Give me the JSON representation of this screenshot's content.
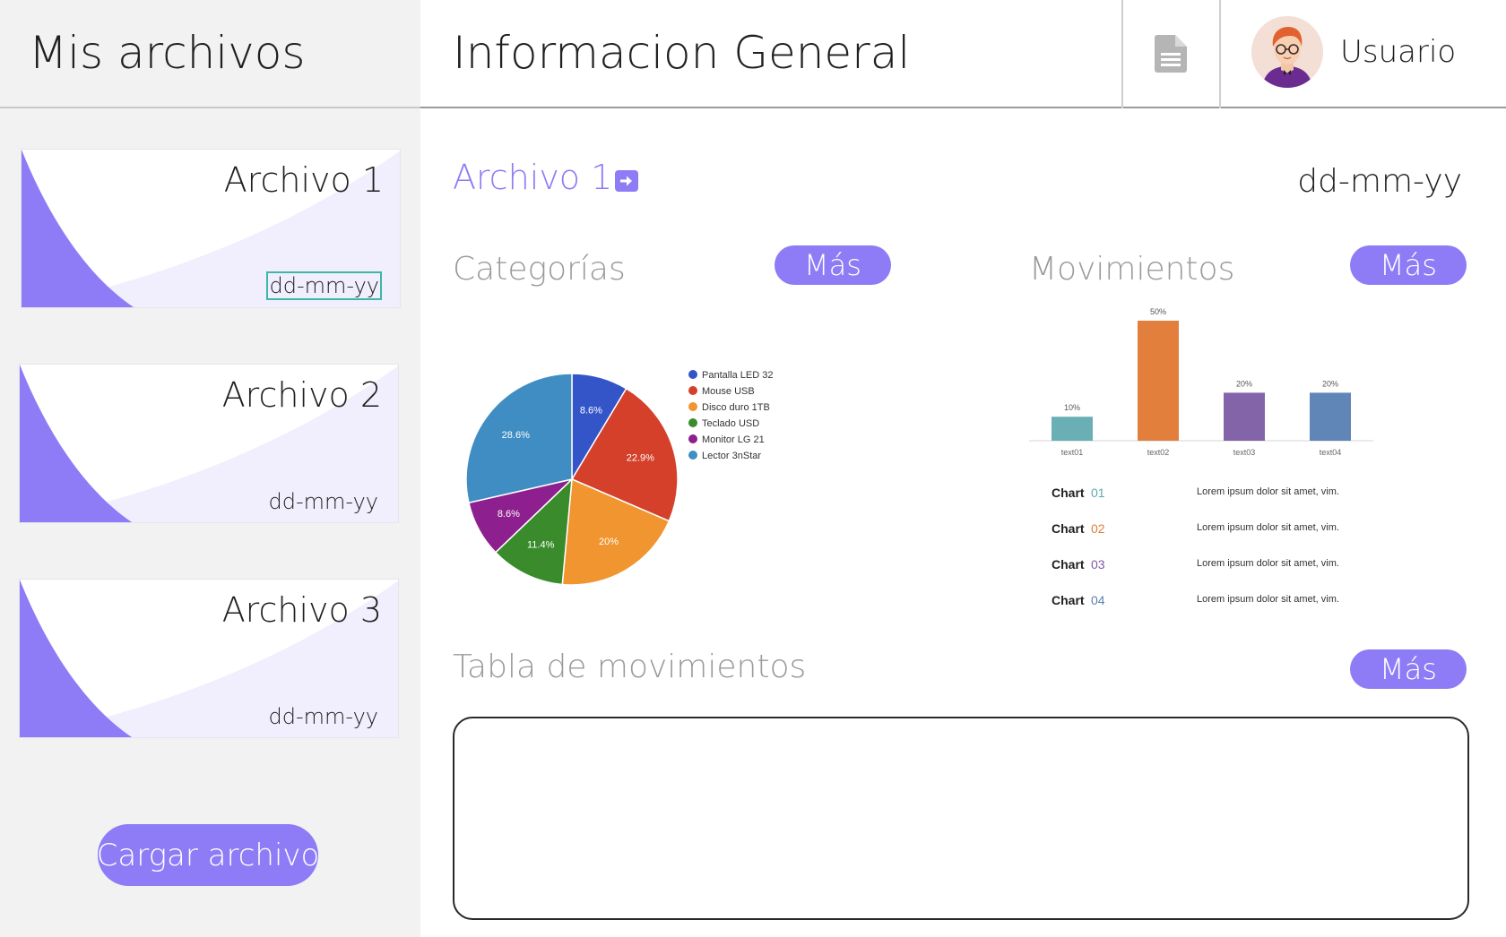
{
  "colors": {
    "accent": "#8d7cf6",
    "sidebar_bg": "#f2f2f2",
    "card_tint": "#f1eefd",
    "muted_text": "#9a9a9a",
    "selection_outline": "#3cb7a8"
  },
  "sidebar": {
    "title": "Mis archivos",
    "files": [
      {
        "name": "Archivo 1",
        "date": "dd-mm-yy",
        "selected": true
      },
      {
        "name": "Archivo 2",
        "date": "dd-mm-yy",
        "selected": false
      },
      {
        "name": "Archivo 3",
        "date": "dd-mm-yy",
        "selected": false
      }
    ],
    "upload_label": "Cargar archivo"
  },
  "header": {
    "title": "Informacion General",
    "doc_icon": "document-icon",
    "user": {
      "name": "Usuario",
      "avatar_icon": "user-avatar-illustration"
    }
  },
  "main": {
    "file_name": "Archivo 1",
    "open_icon": "arrow-right-square-icon",
    "date": "dd-mm-yy",
    "categories": {
      "title": "Categorías",
      "more_label": "Más"
    },
    "movements": {
      "title": "Movimientos",
      "more_label": "Más"
    },
    "table": {
      "title": "Tabla de movimientos",
      "more_label": "Más"
    },
    "chart_notes": [
      {
        "word": "Chart",
        "num": "01",
        "color": "#5fa8b0",
        "text": "Lorem ipsum dolor sit amet, vim."
      },
      {
        "word": "Chart",
        "num": "02",
        "color": "#e07f3a",
        "text": "Lorem ipsum dolor sit amet, vim."
      },
      {
        "word": "Chart",
        "num": "03",
        "color": "#7e5aa6",
        "text": "Lorem ipsum dolor sit amet, vim."
      },
      {
        "word": "Chart",
        "num": "04",
        "color": "#5b7fb0",
        "text": "Lorem ipsum dolor sit amet, vim."
      }
    ]
  },
  "chart_data": [
    {
      "type": "pie",
      "legend_placement": "right",
      "slices": [
        {
          "name": "Pantalla LED 32",
          "value": 8.6,
          "label": "8.6%",
          "color": "#3455c8"
        },
        {
          "name": "Mouse USB",
          "value": 22.9,
          "label": "22.9%",
          "color": "#d4402a"
        },
        {
          "name": "Disco duro 1TB",
          "value": 20,
          "label": "20%",
          "color": "#f0952f"
        },
        {
          "name": "Teclado USD",
          "value": 11.4,
          "label": "11.4%",
          "color": "#3a8b2c"
        },
        {
          "name": "Monitor LG 21",
          "value": 8.6,
          "label": "8.6%",
          "color": "#8e1f8f"
        },
        {
          "name": "Lector 3nStar",
          "value": 28.6,
          "label": "28.6%",
          "color": "#3f8dc2"
        }
      ]
    },
    {
      "type": "bar",
      "categories": [
        "text01",
        "text02",
        "text03",
        "text04"
      ],
      "values": [
        10,
        50,
        20,
        20
      ],
      "value_labels": [
        "10%",
        "50%",
        "20%",
        "20%"
      ],
      "colors": [
        "#6aafb6",
        "#e37f3c",
        "#8464a8",
        "#5f86b6"
      ],
      "ylim": [
        0,
        50
      ],
      "grid": false
    }
  ]
}
